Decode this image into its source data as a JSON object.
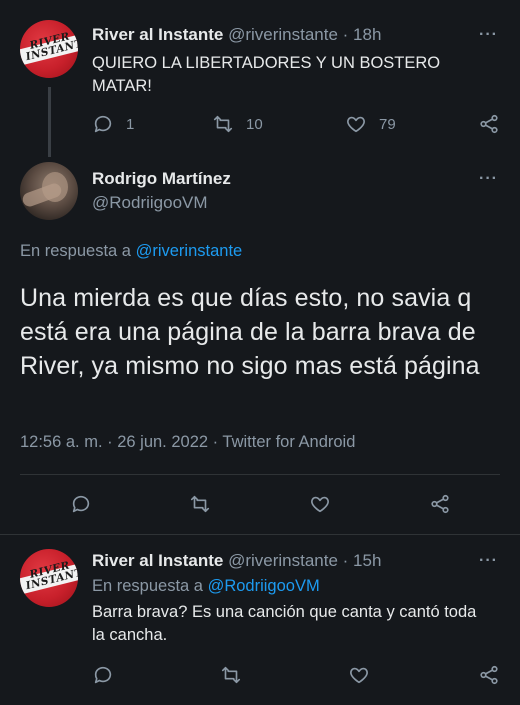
{
  "tweet1": {
    "name": "River al Instante",
    "handle": "@riverinstante",
    "time": "· 18h",
    "avatar_text": "RIVER INSTANTE",
    "text": "QUIERO LA LIBERTADORES Y UN BOSTERO MATAR!",
    "replies": "1",
    "retweets": "10",
    "likes": "79"
  },
  "tweet2": {
    "name": "Rodrigo Martínez",
    "handle": "@RodriigooVM",
    "reply_prefix": "En respuesta a ",
    "reply_handle": "@riverinstante",
    "text": "Una mierda es que días esto, no savia q está era una página de la barra brava de River, ya mismo no sigo mas está página",
    "timestamp": "12:56 a. m. · 26 jun. 2022 · Twitter for Android"
  },
  "tweet3": {
    "name": "River al Instante",
    "handle": "@riverinstante",
    "time": "· 15h",
    "avatar_text": "RIVER INSTANTE",
    "reply_prefix": "En respuesta a ",
    "reply_handle": "@RodriigooVM",
    "text": "Barra brava? Es una canción que canta y cantó toda la cancha."
  },
  "icons": [
    "more-icon",
    "reply-icon",
    "retweet-icon",
    "like-icon",
    "share-icon"
  ],
  "colors": {
    "background": "#15181c",
    "link": "#1d9bf0",
    "muted": "#8b98a5",
    "text": "#e7e9ea"
  }
}
